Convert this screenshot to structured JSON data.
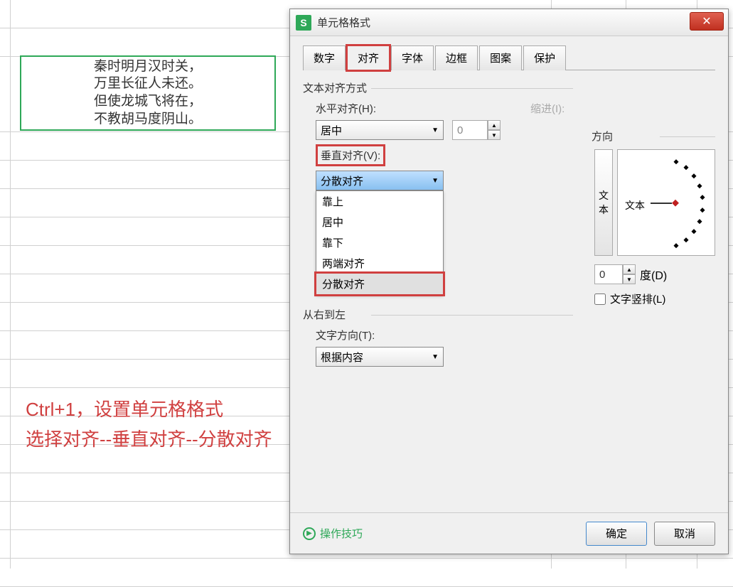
{
  "poem": {
    "line1": "秦时明月汉时关，",
    "line2": "万里长征人未还。",
    "line3": "但使龙城飞将在，",
    "line4": "不教胡马度阴山。"
  },
  "annotation": {
    "line1": "Ctrl+1，设置单元格格式",
    "line2": "选择对齐--垂直对齐--分散对齐"
  },
  "dialog": {
    "title": "单元格格式",
    "close": "✕",
    "tabs": {
      "number": "数字",
      "align": "对齐",
      "font": "字体",
      "border": "边框",
      "pattern": "图案",
      "protect": "保护"
    },
    "align_section": {
      "title": "文本对齐方式",
      "horizontal_label": "水平对齐(H):",
      "horizontal_value": "居中",
      "indent_label": "缩进(I):",
      "indent_value": "0",
      "vertical_label": "垂直对齐(V):",
      "vertical_value": "分散对齐",
      "options": {
        "top": "靠上",
        "center": "居中",
        "bottom": "靠下",
        "justify": "两端对齐",
        "distribute": "分散对齐"
      }
    },
    "rtl_section": {
      "title": "从右到左",
      "text_dir_label": "文字方向(T):",
      "text_dir_value": "根据内容"
    },
    "direction": {
      "title": "方向",
      "vert_text": "文本",
      "arc_text": "文本",
      "degree_value": "0",
      "degree_label": "度(D)",
      "vertical_checkbox": "文字竖排(L)"
    },
    "footer": {
      "tips": "操作技巧",
      "ok": "确定",
      "cancel": "取消"
    }
  }
}
